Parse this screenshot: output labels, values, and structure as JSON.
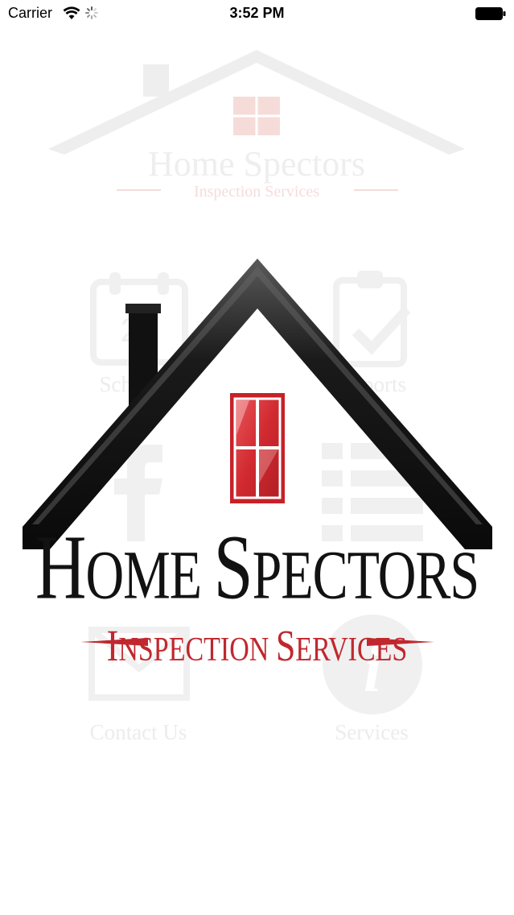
{
  "status_bar": {
    "carrier": "Carrier",
    "time": "3:52 PM"
  },
  "background_menu": {
    "header_logo_title": "Home Spectors",
    "header_logo_subtitle": "Inspection Services",
    "items": [
      {
        "label": "Schedule",
        "icon": "calendar-icon"
      },
      {
        "label": "Reports",
        "icon": "clipboard-check-icon"
      },
      {
        "label": "",
        "icon": "facebook-icon"
      },
      {
        "label": "",
        "icon": "list-icon"
      },
      {
        "label": "Contact Us",
        "icon": "envelope-icon"
      },
      {
        "label": "Services",
        "icon": "info-icon"
      }
    ]
  },
  "splash": {
    "title_initial_1": "H",
    "title_rest_1": "OME ",
    "title_initial_2": "S",
    "title_rest_2": "PECTORS",
    "subtitle_initial_1": "I",
    "subtitle_rest_1": "NSPECTION ",
    "subtitle_initial_2": "S",
    "subtitle_rest_2": "ERVICES"
  },
  "colors": {
    "brand_red": "#c0282e",
    "roof_black": "#111111",
    "faded_gray": "#ececec"
  }
}
